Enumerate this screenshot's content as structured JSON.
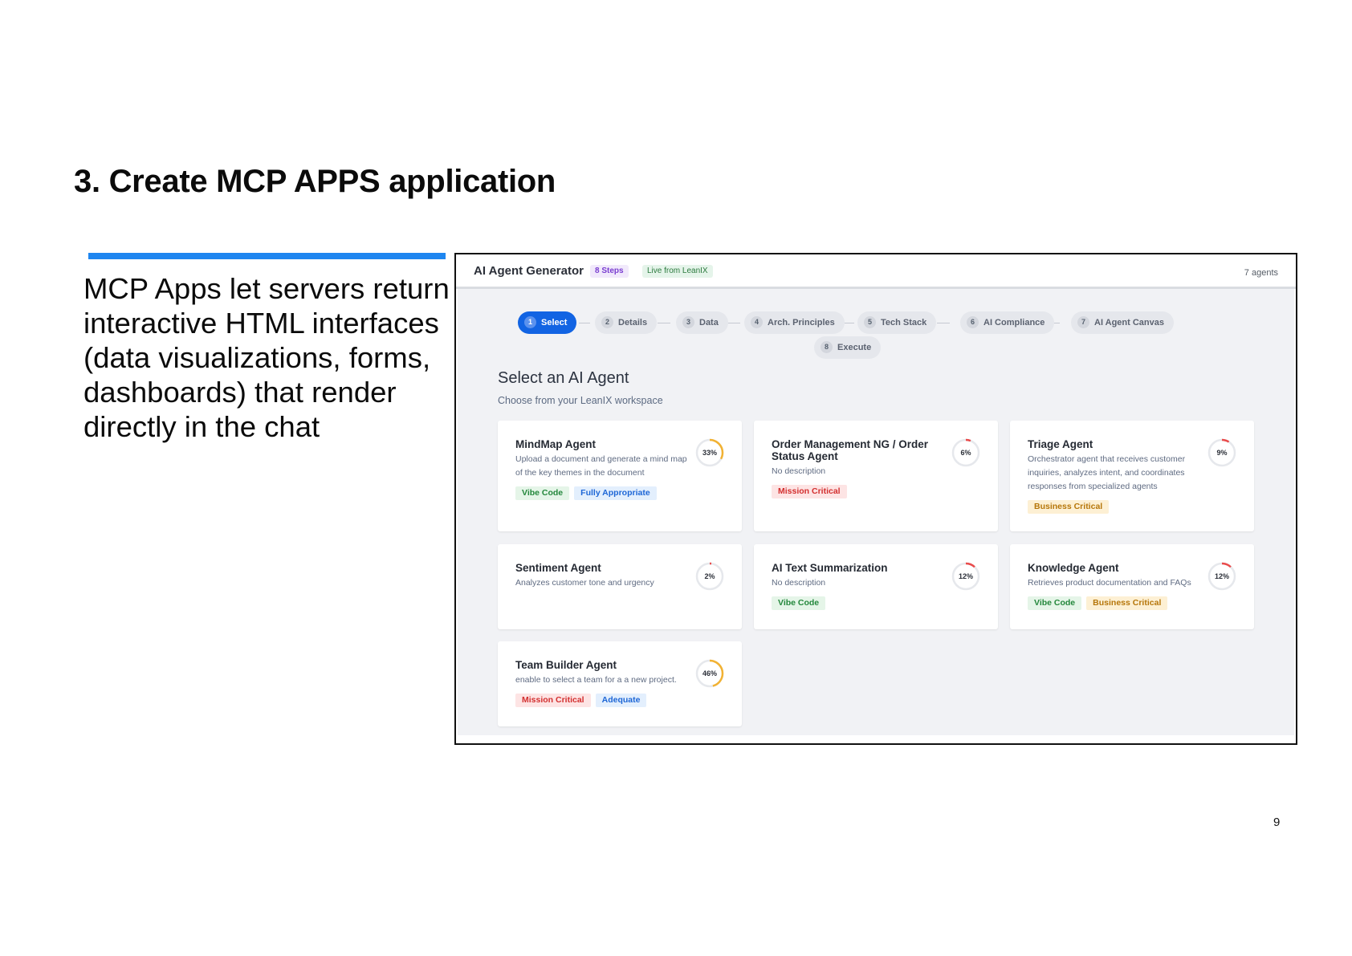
{
  "slide": {
    "title": "3. Create MCP APPS application",
    "body": "MCP Apps let servers return interactive HTML interfaces (data visualizations, forms, dashboards) that render directly in the chat",
    "page_number": "9",
    "accent_color": "#1f86f0"
  },
  "app": {
    "title": "AI Agent Generator",
    "steps_badge": "8 Steps",
    "live_badge": "Live from LeanIX",
    "agent_count": "7 agents"
  },
  "steps": [
    {
      "num": "1",
      "label": "Select",
      "active": true
    },
    {
      "num": "2",
      "label": "Details"
    },
    {
      "num": "3",
      "label": "Data"
    },
    {
      "num": "4",
      "label": "Arch. Principles"
    },
    {
      "num": "5",
      "label": "Tech Stack"
    },
    {
      "num": "6",
      "label": "AI Compliance"
    },
    {
      "num": "7",
      "label": "AI Agent Canvas"
    },
    {
      "num": "8",
      "label": "Execute"
    }
  ],
  "section": {
    "title": "Select an AI Agent",
    "subtitle": "Choose from your LeanIX workspace"
  },
  "agents": [
    {
      "name": "MindMap Agent",
      "description": "Upload a document and generate a mind map of the key themes in the document",
      "progress_label": "33%",
      "progress": 0.33,
      "ring_color": "#f2b233",
      "tags": [
        {
          "label": "Vibe Code",
          "color": "green"
        },
        {
          "label": "Fully Appropriate",
          "color": "blue"
        }
      ]
    },
    {
      "name": "Order Management NG / Order Status Agent",
      "description": "No description",
      "progress_label": "6%",
      "progress": 0.06,
      "ring_color": "#e94b4b",
      "tags": [
        {
          "label": "Mission Critical",
          "color": "red"
        }
      ]
    },
    {
      "name": "Triage Agent",
      "description": "Orchestrator agent that receives customer inquiries, analyzes intent, and coordinates responses from specialized agents",
      "progress_label": "9%",
      "progress": 0.09,
      "ring_color": "#e94b4b",
      "tags": [
        {
          "label": "Business Critical",
          "color": "amber"
        }
      ]
    },
    {
      "name": "Sentiment Agent",
      "description": "Analyzes customer tone and urgency",
      "progress_label": "2%",
      "progress": 0.02,
      "ring_color": "#e94b4b",
      "tags": []
    },
    {
      "name": "AI Text Summarization",
      "description": "No description",
      "progress_label": "12%",
      "progress": 0.12,
      "ring_color": "#e94b4b",
      "tags": [
        {
          "label": "Vibe Code",
          "color": "green"
        }
      ]
    },
    {
      "name": "Knowledge Agent",
      "description": "Retrieves product documentation and FAQs",
      "progress_label": "12%",
      "progress": 0.12,
      "ring_color": "#e94b4b",
      "tags": [
        {
          "label": "Vibe Code",
          "color": "green"
        },
        {
          "label": "Business Critical",
          "color": "amber"
        }
      ]
    },
    {
      "name": "Team Builder Agent",
      "description": "enable to select a team for a a new project.",
      "progress_label": "46%",
      "progress": 0.46,
      "ring_color": "#f2b233",
      "tags": [
        {
          "label": "Mission Critical",
          "color": "red"
        },
        {
          "label": "Adequate",
          "color": "blue"
        }
      ]
    }
  ]
}
